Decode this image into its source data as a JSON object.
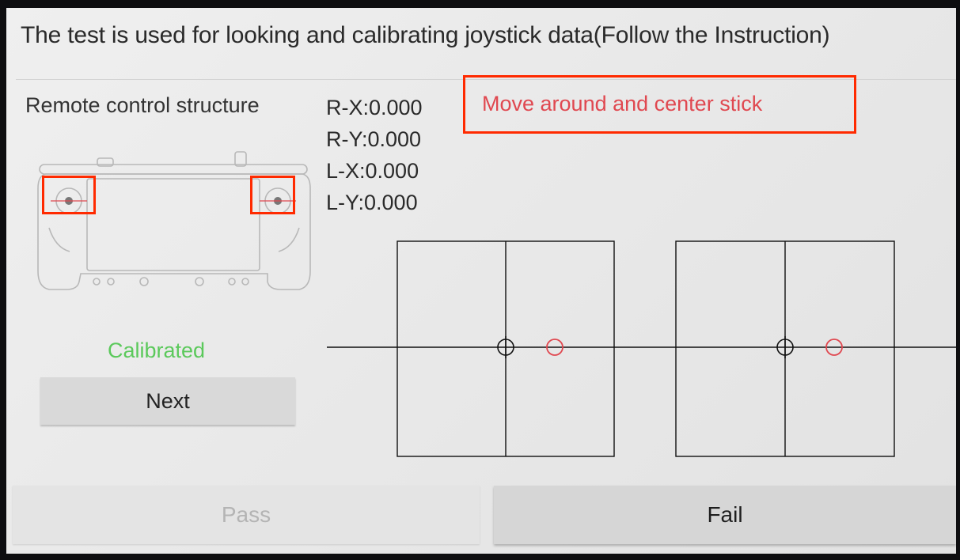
{
  "header": {
    "title": "The test is used for looking and calibrating joystick data(Follow the Instruction)"
  },
  "structure": {
    "label": "Remote control structure"
  },
  "readouts": [
    {
      "label": "R-X:0.000"
    },
    {
      "label": "R-Y:0.000"
    },
    {
      "label": "L-X:0.000"
    },
    {
      "label": "L-Y:0.000"
    }
  ],
  "instruction": {
    "text": "Move around and center stick",
    "color": "#e04850",
    "box_color": "#ff2a00"
  },
  "status": {
    "text": "Calibrated",
    "color": "#5bc95b"
  },
  "buttons": {
    "next": "Next",
    "pass": "Pass",
    "fail": "Fail"
  },
  "joysticks": [
    {
      "name": "left-stick",
      "x": 0.0,
      "y": 0.0,
      "target_color": "#e04850",
      "center_color": "#111111"
    },
    {
      "name": "right-stick",
      "x": 0.0,
      "y": 0.0,
      "target_color": "#e04850",
      "center_color": "#111111"
    }
  ]
}
